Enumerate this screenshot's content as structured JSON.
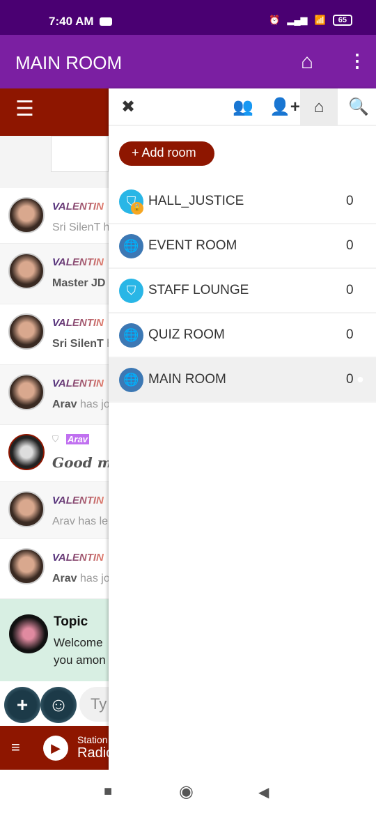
{
  "status": {
    "time": "7:40 AM",
    "battery": "65",
    "icons": [
      "youtube-icon",
      "alarm-icon",
      "volte-icon",
      "signal-icon",
      "wifi-icon"
    ]
  },
  "appbar": {
    "title": "MAIN ROOM",
    "icons": [
      "home-icon",
      "more-vert-icon"
    ]
  },
  "chat": {
    "rows": [
      {
        "name": "VALENTIN",
        "user": "Sri SilenT",
        "text": "h"
      },
      {
        "name": "VALENTIN",
        "user": "Master JD",
        "text": ""
      },
      {
        "name": "VALENTIN",
        "user": "Sri SilenT",
        "text": "h"
      },
      {
        "name": "VALENTIN",
        "user": "Arav",
        "text": "has jo"
      },
      {
        "name": "Arav",
        "user": "Good mo",
        "text": ""
      },
      {
        "name": "VALENTIN",
        "user": "Arav has le",
        "text": ""
      },
      {
        "name": "VALENTIN",
        "user": "Arav",
        "text": "has jo"
      }
    ],
    "topic": {
      "title": "Topic",
      "line1": "Welcome",
      "line2": "you amon"
    },
    "input_placeholder": "Ty",
    "radio": {
      "station_label": "Station",
      "name": "Radio"
    }
  },
  "drawer": {
    "add_room": "+ Add room",
    "icons": [
      "close-icon",
      "users-icon",
      "add-user-icon",
      "home-icon",
      "search-icon"
    ],
    "rooms": [
      {
        "name": "HALL_JUSTICE",
        "count": "0",
        "icon": "shield",
        "locked": true
      },
      {
        "name": "EVENT ROOM",
        "count": "0",
        "icon": "globe"
      },
      {
        "name": "STAFF LOUNGE",
        "count": "0",
        "icon": "shield"
      },
      {
        "name": "QUIZ ROOM",
        "count": "0",
        "icon": "globe"
      },
      {
        "name": "MAIN ROOM",
        "count": "0",
        "icon": "globe",
        "active": true
      }
    ]
  },
  "colors": {
    "status": "#4a0072",
    "appbar": "#7b1fa2",
    "accent": "#8e1600"
  }
}
